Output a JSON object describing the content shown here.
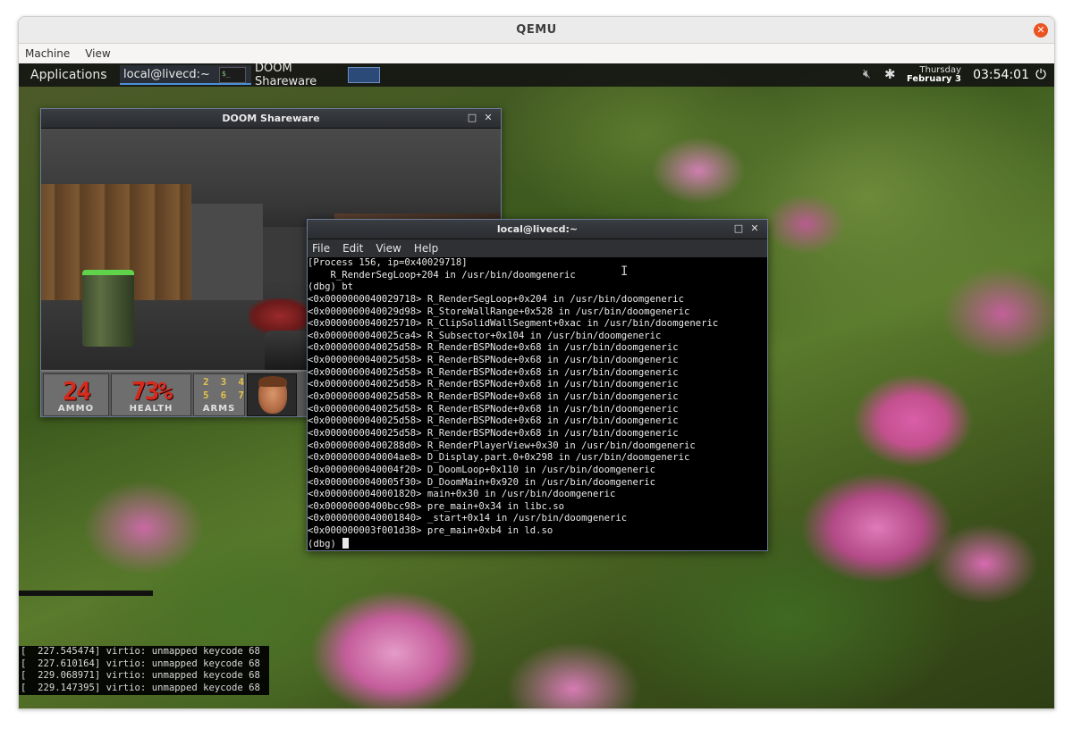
{
  "qemu": {
    "title": "QEMU",
    "menu": [
      "Machine",
      "View"
    ]
  },
  "panel": {
    "applications": "Applications",
    "tasks": [
      {
        "label": "local@livecd:~",
        "thumb": "$_"
      },
      {
        "label": "DOOM Shareware"
      }
    ],
    "clock": {
      "day": "Thursday",
      "date": "February 3",
      "time": "03:54:01"
    },
    "icons": [
      "volume-muted-icon",
      "network-icon",
      "power-icon"
    ]
  },
  "doom_window": {
    "title": "DOOM Shareware",
    "hud": {
      "ammo": "24",
      "ammo_label": "AMMO",
      "health": "73%",
      "health_label": "HEALTH",
      "arms": [
        "2",
        "3",
        "4",
        "5",
        "6",
        "7"
      ],
      "arms_label": "ARMS"
    }
  },
  "terminal_window": {
    "title": "local@livecd:~",
    "menu": [
      "File",
      "Edit",
      "View",
      "Help"
    ],
    "lines": [
      "[Process 156, ip=0x40029718]",
      "    R_RenderSegLoop+204 in /usr/bin/doomgeneric",
      "(dbg) bt",
      "<0x0000000040029718> R_RenderSegLoop+0x204 in /usr/bin/doomgeneric",
      "<0x0000000040029d98> R_StoreWallRange+0x528 in /usr/bin/doomgeneric",
      "<0x0000000040025710> R_ClipSolidWallSegment+0xac in /usr/bin/doomgeneric",
      "<0x0000000040025ca4> R_Subsector+0x104 in /usr/bin/doomgeneric",
      "<0x0000000040025d58> R_RenderBSPNode+0x68 in /usr/bin/doomgeneric",
      "<0x0000000040025d58> R_RenderBSPNode+0x68 in /usr/bin/doomgeneric",
      "<0x0000000040025d58> R_RenderBSPNode+0x68 in /usr/bin/doomgeneric",
      "<0x0000000040025d58> R_RenderBSPNode+0x68 in /usr/bin/doomgeneric",
      "<0x0000000040025d58> R_RenderBSPNode+0x68 in /usr/bin/doomgeneric",
      "<0x0000000040025d58> R_RenderBSPNode+0x68 in /usr/bin/doomgeneric",
      "<0x0000000040025d58> R_RenderBSPNode+0x68 in /usr/bin/doomgeneric",
      "<0x0000000040025d58> R_RenderBSPNode+0x68 in /usr/bin/doomgeneric",
      "<0x00000000400288d0> R_RenderPlayerView+0x30 in /usr/bin/doomgeneric",
      "<0x0000000040004ae8> D_Display.part.0+0x298 in /usr/bin/doomgeneric",
      "<0x0000000040004f20> D_DoomLoop+0x110 in /usr/bin/doomgeneric",
      "<0x0000000040005f30> D_DoomMain+0x920 in /usr/bin/doomgeneric",
      "<0x0000000040001820> main+0x30 in /usr/bin/doomgeneric",
      "<0x00000000400bcc98> pre_main+0x34 in libc.so",
      "<0x0000000040001840> _start+0x14 in /usr/bin/doomgeneric",
      "<0x000000003f001d38> pre_main+0xb4 in ld.so"
    ],
    "prompt": "(dbg) "
  },
  "kernel_console": [
    "[  227.545474] virtio: unmapped keycode 68",
    "[  227.610164] virtio: unmapped keycode 68",
    "[  229.068971] virtio: unmapped keycode 68",
    "[  229.147395] virtio: unmapped keycode 68"
  ]
}
